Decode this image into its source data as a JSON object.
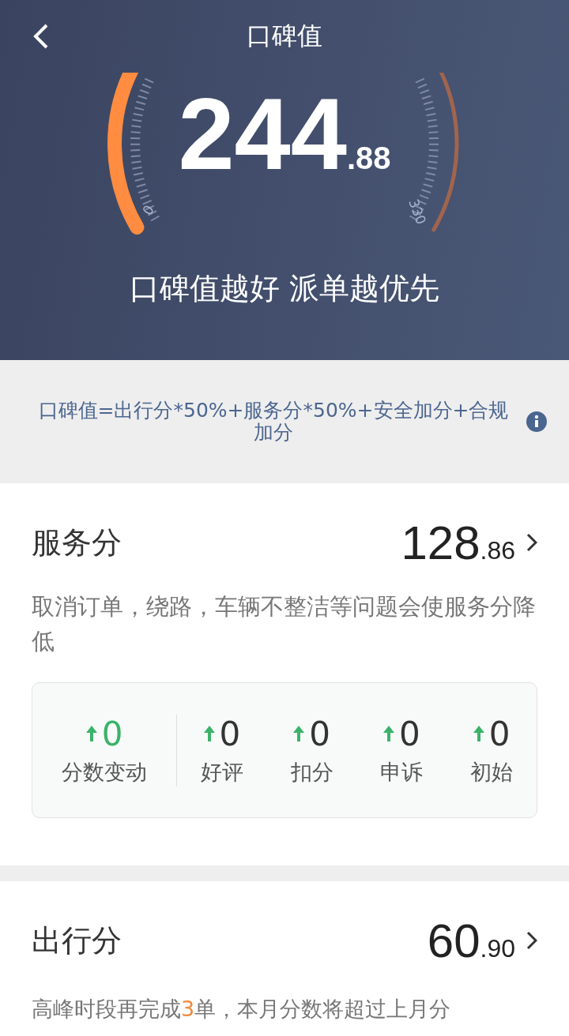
{
  "header": {
    "title": "口碑值"
  },
  "gauge": {
    "integer": "244",
    "decimal": ".88",
    "min_label": "0",
    "max_label": "330",
    "slogan": "口碑值越好 派单越优先"
  },
  "formula": {
    "text": "口碑值=出行分*50%+服务分*50%+安全加分+合规加分"
  },
  "service": {
    "title": "服务分",
    "integer": "128",
    "decimal": ".86",
    "description": "取消订单，绕路，车辆不整洁等问题会使服务分降低",
    "stats": [
      {
        "value": "0",
        "label": "分数变动"
      },
      {
        "value": "0",
        "label": "好评"
      },
      {
        "value": "0",
        "label": "扣分"
      },
      {
        "value": "0",
        "label": "申诉"
      },
      {
        "value": "0",
        "label": "初始"
      }
    ]
  },
  "trip": {
    "title": "出行分",
    "integer": "60",
    "decimal": ".90",
    "hint_before": "高峰时段再完成",
    "hint_highlight": "3",
    "hint_after": "单，本月分数将超过上月分"
  }
}
